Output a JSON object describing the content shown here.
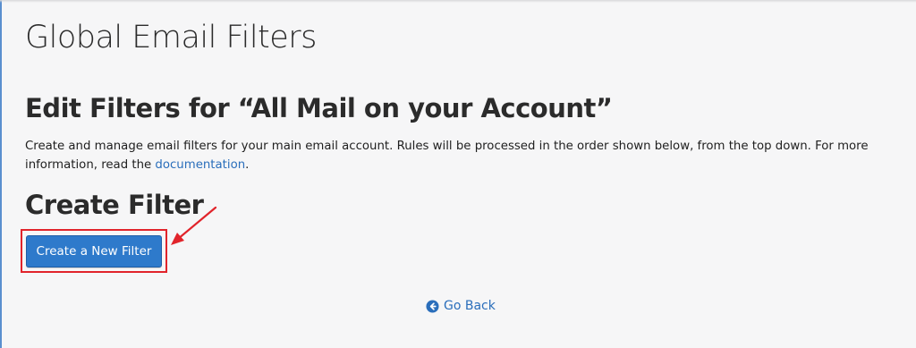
{
  "page": {
    "title": "Global Email Filters"
  },
  "edit_section": {
    "heading": "Edit Filters for “All Mail on your Account”",
    "description_prefix": "Create and manage email filters for your main email account. Rules will be processed in the order shown below, from the top down. For more information, read the ",
    "description_link": "documentation",
    "description_suffix": "."
  },
  "create_section": {
    "heading": "Create Filter",
    "button_label": "Create a New Filter"
  },
  "footer": {
    "go_back_label": "Go Back"
  },
  "colors": {
    "accent": "#2e7acb",
    "link": "#2a6ebb",
    "annotation": "#e1242b"
  },
  "icons": {
    "go_back": "arrow-circle-left-icon",
    "annotation_arrow": "annotation-arrow-icon"
  }
}
